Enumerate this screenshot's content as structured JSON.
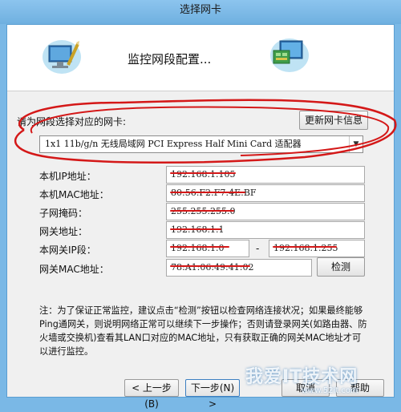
{
  "window": {
    "title": "选择网卡"
  },
  "banner": {
    "title": "监控网段配置..."
  },
  "adapter": {
    "prompt": "请为网段选择对应的网卡:",
    "refresh_label": "更新网卡信息",
    "selected": "1x1 11b/g/n 无线局域网 PCI Express Half Mini Card 适配器"
  },
  "fields": {
    "local_ip": {
      "label": "本机IP地址：",
      "value": "192.168.1.105"
    },
    "local_mac": {
      "label": "本机MAC地址：",
      "value": "80:56:F2:F7:4E:BF"
    },
    "subnet_mask": {
      "label": "子网掩码：",
      "value": "255.255.255.0"
    },
    "gateway": {
      "label": "网关地址：",
      "value": "192.168.1.1"
    },
    "segment": {
      "label": "本网关IP段：",
      "start": "192.168.1.0",
      "separator": "-",
      "end": "192.168.1.255"
    },
    "gateway_mac": {
      "label": "网关MAC地址：",
      "value": "78:A1:06:49:41:02",
      "detect_label": "检测"
    }
  },
  "note": "注：为了保证正常监控，建议点击“检测”按钮以检查网络连接状况；如果最终能够Ping通网关，则说明网络正常可以继续下一步操作；否则请登录网关(如路由器、防火墙或交换机)查看其LAN口对应的MAC地址，只有获取正确的网关MAC地址才可以进行监控。",
  "buttons": {
    "back": "< 上一步(B)",
    "next": "下一步(N) >",
    "cancel": "取消",
    "help": "帮助"
  },
  "watermark": {
    "text": "我爱IT技术网",
    "url": "www.52it.com"
  },
  "colors": {
    "annotation": "#d41818",
    "title_bar": "#7ab8e6"
  }
}
